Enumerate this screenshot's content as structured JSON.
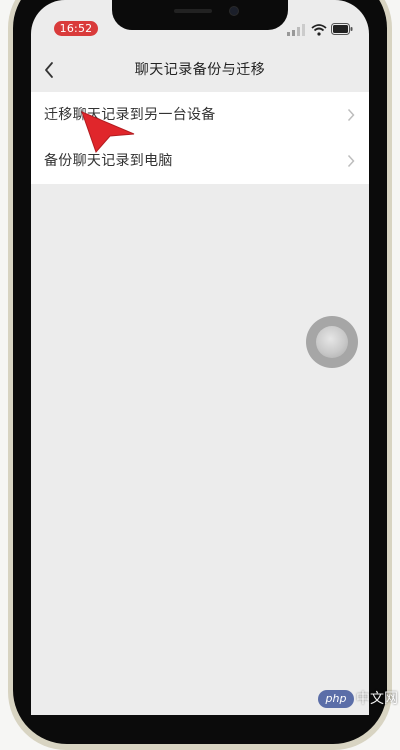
{
  "status_bar": {
    "time": "16:52"
  },
  "header": {
    "title": "聊天记录备份与迁移"
  },
  "menu": {
    "items": [
      {
        "label": "迁移聊天记录到另一台设备"
      },
      {
        "label": "备份聊天记录到电脑"
      }
    ]
  },
  "watermark": {
    "badge": "php",
    "text": "中文网"
  },
  "colors": {
    "time_pill": "#d93b3b",
    "pointer": "#e0262b",
    "screen_bg": "#ececec",
    "list_bg": "#ffffff"
  },
  "icons": [
    "signal-icon",
    "wifi-icon",
    "battery-icon",
    "back-icon",
    "chevron-right-icon",
    "pointer-arrow-icon"
  ]
}
